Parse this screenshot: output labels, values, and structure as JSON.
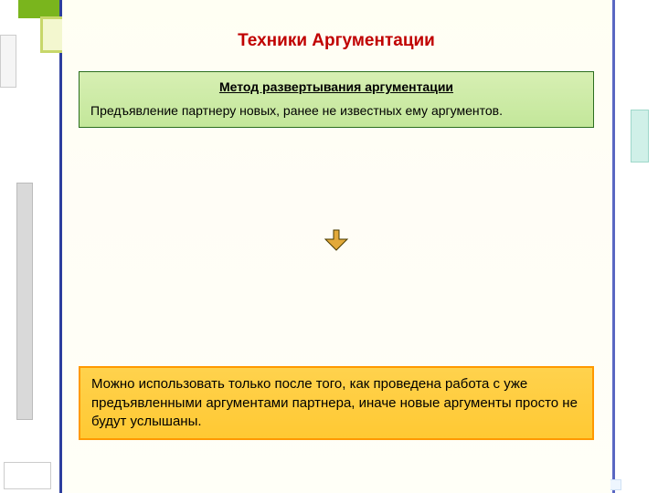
{
  "title": "Техники Аргументации",
  "method": {
    "heading": "Метод развертывания аргументации",
    "body": "Предъявление партнеру новых, ранее не известных ему аргументов."
  },
  "note": "Можно использовать только после того, как проведена работа с уже предъявленными аргументами партнера, иначе новые аргументы просто не будут услышаны."
}
